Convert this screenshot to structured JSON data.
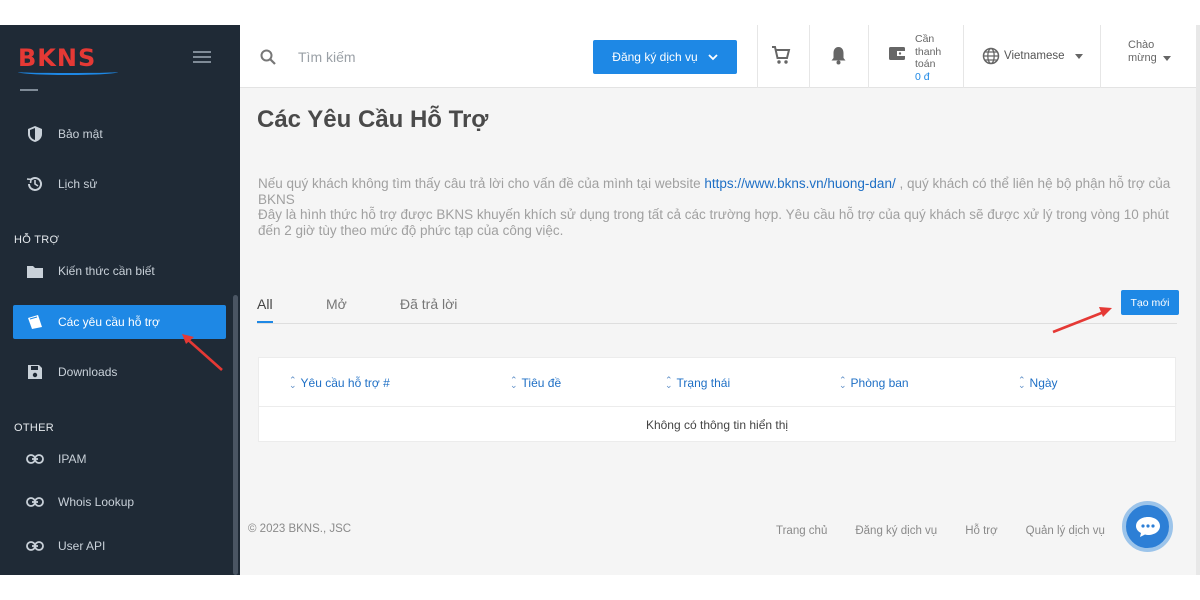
{
  "brand": {
    "logo_text": "BKNS",
    "logo_color": "#e53935",
    "accent": "#1e88e5"
  },
  "sidebar": {
    "items_top": [
      {
        "label": "Bảo mật",
        "icon": "shield-icon"
      },
      {
        "label": "Lịch sử",
        "icon": "history-icon"
      }
    ],
    "section_support": "HỖ TRỢ",
    "support_items": [
      {
        "label": "Kiến thức cần biết",
        "icon": "folder-icon"
      },
      {
        "label": "Các yêu cầu hỗ trợ",
        "icon": "ticket-icon",
        "active": true
      },
      {
        "label": "Downloads",
        "icon": "save-icon"
      }
    ],
    "section_other": "OTHER",
    "other_items": [
      {
        "label": "IPAM",
        "icon": "link-icon"
      },
      {
        "label": "Whois Lookup",
        "icon": "link-icon"
      },
      {
        "label": "User API",
        "icon": "link-icon"
      }
    ]
  },
  "topbar": {
    "search_placeholder": "Tìm kiếm",
    "register_label": "Đăng ký dịch vụ",
    "payment_label_1": "Cần",
    "payment_label_2": "thanh",
    "payment_label_3": "toán",
    "payment_amount": "0 đ",
    "language": "Vietnamese",
    "greeting_1": "Chào",
    "greeting_2": "mừng"
  },
  "main": {
    "title": "Các Yêu Cầu Hỗ Trợ",
    "desc_part1": "Nếu quý khách không tìm thấy câu trả lời cho vấn đề của mình tại website ",
    "desc_link": "https://www.bkns.vn/huong-dan/",
    "desc_part2": " , quý khách có thể liên hệ bộ phận hỗ trợ của BKNS",
    "desc_line2": "Đây là hình thức hỗ trợ được BKNS khuyến khích sử dụng trong tất cả các trường hợp. Yêu cầu hỗ trợ của quý khách sẽ được xử lý trong vòng 10 phút đến 2 giờ tùy theo mức độ phức tạp của công việc.",
    "tabs": [
      "All",
      "Mở",
      "Đã trả lời"
    ],
    "create_label": "Tạo mới",
    "table_headers": [
      "Yêu cầu hỗ trợ #",
      "Tiêu đề",
      "Trạng thái",
      "Phòng ban",
      "Ngày"
    ],
    "empty_text": "Không có thông tin hiển thị"
  },
  "footer": {
    "copyright": "© 2023 BKNS., JSC",
    "links": [
      "Trang chủ",
      "Đăng ký dịch vụ",
      "Hỗ trợ",
      "Quản lý dịch vụ"
    ]
  }
}
